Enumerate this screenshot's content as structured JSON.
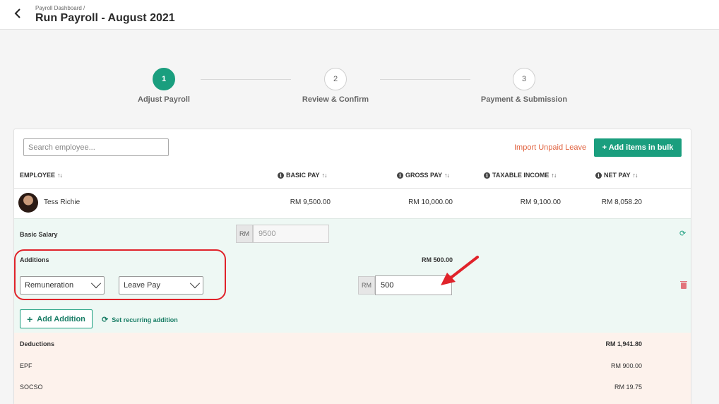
{
  "header": {
    "breadcrumb": "Payroll Dashboard /",
    "title": "Run Payroll - August 2021"
  },
  "steps": [
    {
      "number": "1",
      "label": "Adjust Payroll",
      "active": true
    },
    {
      "number": "2",
      "label": "Review & Confirm",
      "active": false
    },
    {
      "number": "3",
      "label": "Payment & Submission",
      "active": false
    }
  ],
  "toolbar": {
    "search_placeholder": "Search employee...",
    "import_label": "Import Unpaid Leave",
    "bulk_label": "+ Add items in bulk"
  },
  "table": {
    "columns": [
      "EMPLOYEE",
      "BASIC PAY",
      "GROSS PAY",
      "TAXABLE INCOME",
      "NET PAY"
    ],
    "row": {
      "name": "Tess Richie",
      "basic_pay": "RM 9,500.00",
      "gross_pay": "RM 10,000.00",
      "taxable_income": "RM 9,100.00",
      "net_pay": "RM 8,058.20"
    }
  },
  "basic_salary": {
    "label": "Basic Salary",
    "currency": "RM",
    "value": "9500"
  },
  "additions": {
    "label": "Additions",
    "total": "RM 500.00",
    "type_select": "Remuneration",
    "item_select": "Leave Pay",
    "currency": "RM",
    "amount": "500",
    "add_button": "Add Addition",
    "recurring_link": "Set recurring addition"
  },
  "deductions": {
    "label": "Deductions",
    "total": "RM 1,941.80",
    "items": [
      {
        "name": "EPF",
        "value": "RM 900.00"
      },
      {
        "name": "SOCSO",
        "value": "RM 19.75"
      }
    ]
  },
  "colors": {
    "accent": "#1a9e7e",
    "warning_link": "#e0623f",
    "highlight": "#e0232a"
  }
}
